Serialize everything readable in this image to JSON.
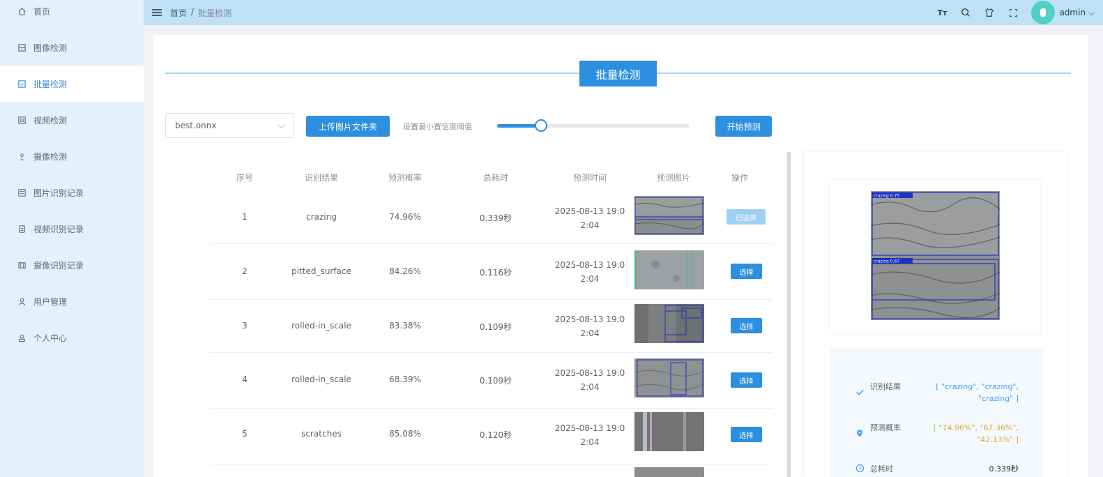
{
  "sidebar": {
    "items": [
      {
        "label": "首页",
        "icon": "home-icon",
        "active": false
      },
      {
        "label": "图像检测",
        "icon": "image-icon",
        "active": false
      },
      {
        "label": "批量检测",
        "icon": "batch-icon",
        "active": true
      },
      {
        "label": "视频检测",
        "icon": "video-icon",
        "active": false
      },
      {
        "label": "摄像检测",
        "icon": "camera-icon",
        "active": false
      },
      {
        "label": "图片识别记录",
        "icon": "image-record-icon",
        "active": false
      },
      {
        "label": "视频识别记录",
        "icon": "video-record-icon",
        "active": false
      },
      {
        "label": "摄像识别记录",
        "icon": "camera-record-icon",
        "active": false
      },
      {
        "label": "用户管理",
        "icon": "user-icon",
        "active": false
      },
      {
        "label": "个人中心",
        "icon": "profile-icon",
        "active": false
      }
    ]
  },
  "header": {
    "breadcrumb_home": "首页",
    "breadcrumb_sep": "/",
    "breadcrumb_current": "批量检测",
    "font_icon_text": "Tт",
    "user_name": "admin"
  },
  "page": {
    "title": "批量检测",
    "model_select_value": "best.onnx",
    "upload_label": "上传图片文件夹",
    "threshold_label": "设置最小置信度阈值",
    "threshold_value": 0.23,
    "start_label": "开始预测"
  },
  "table": {
    "headers": [
      "序号",
      "识别结果",
      "预测概率",
      "总耗时",
      "预测时间",
      "预测图片",
      "操作"
    ],
    "rows": [
      {
        "index": "1",
        "result": "crazing",
        "prob": "74.96%",
        "time": "0.339秒",
        "date_line1": "2025-08-13 19:0",
        "date_line2": "2:04",
        "action": "已选择",
        "selected": true
      },
      {
        "index": "2",
        "result": "pitted_surface",
        "prob": "84.26%",
        "time": "0.116秒",
        "date_line1": "2025-08-13 19:0",
        "date_line2": "2:04",
        "action": "选择",
        "selected": false
      },
      {
        "index": "3",
        "result": "rolled-in_scale",
        "prob": "83.38%",
        "time": "0.109秒",
        "date_line1": "2025-08-13 19:0",
        "date_line2": "2:04",
        "action": "选择",
        "selected": false
      },
      {
        "index": "4",
        "result": "rolled-in_scale",
        "prob": "68.39%",
        "time": "0.109秒",
        "date_line1": "2025-08-13 19:0",
        "date_line2": "2:04",
        "action": "选择",
        "selected": false
      },
      {
        "index": "5",
        "result": "scratches",
        "prob": "85.08%",
        "time": "0.120秒",
        "date_line1": "2025-08-13 19:0",
        "date_line2": "2:04",
        "action": "选择",
        "selected": false
      }
    ]
  },
  "detail": {
    "box_label_1": "crazing 0.75",
    "box_label_2": "crazing 0.67",
    "result_label": "识别结果",
    "result_value": "[ \"crazing\", \"crazing\", \"crazing\" ]",
    "prob_label": "预测概率",
    "prob_value": "[ \"74.96%\", \"67.36%\", \"42.13%\" ]",
    "time_label": "总耗时",
    "time_value": "0.339秒"
  },
  "colors": {
    "primary": "#2d8fe0",
    "sidebar_bg": "#e3f1fb",
    "topbar_bg": "#bfe0f7",
    "prob_text": "#e6a23c",
    "result_text": "#409eff"
  }
}
